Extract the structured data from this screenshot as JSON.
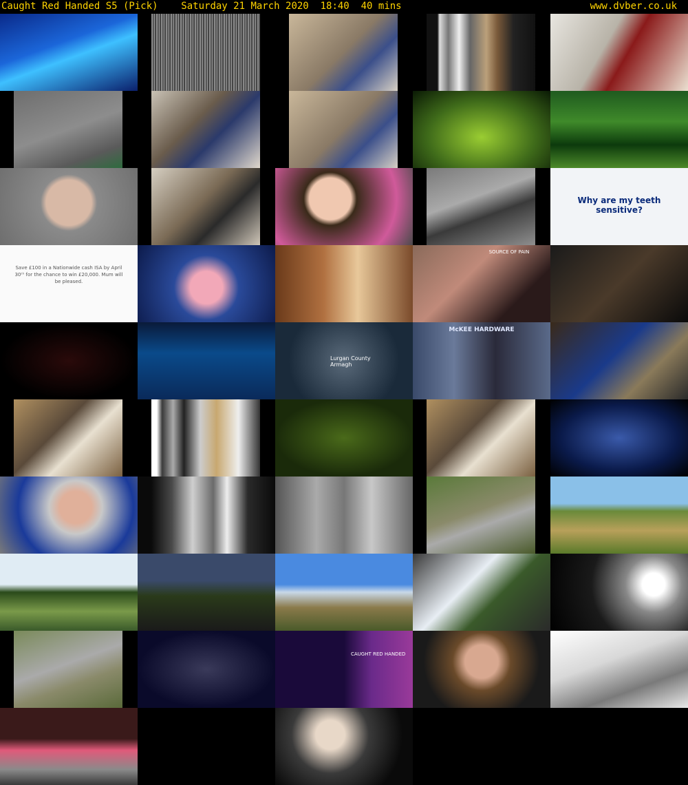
{
  "header": {
    "title": "Caught Red Handed S5 (Pick)",
    "date": "Saturday 21 March 2020",
    "time": "18:40",
    "duration": "40 mins",
    "site": "www.dvber.co.uk"
  },
  "thumbnails": [
    {
      "id": 1,
      "desc": "game-show-studio",
      "bg": "linear-gradient(160deg,#0a2a8a 0%,#1b66d9 40%,#3ec0ff 55%,#0b1f6b 100%)",
      "fit": "full"
    },
    {
      "id": 2,
      "desc": "static-noise",
      "bg": "repeating-linear-gradient(90deg,#888 0 2px,#555 2px 4px,#999 4px 5px,#444 5px 7px)",
      "fit": "pb"
    },
    {
      "id": 3,
      "desc": "cctv-shop-counter",
      "bg": "linear-gradient(135deg,#c9b79a,#8a7a66 50%,#3b4f8a 70%,#d7d0c4)",
      "fit": "pb"
    },
    {
      "id": 4,
      "desc": "grey-stripes",
      "bg": "linear-gradient(90deg,#111 0 10%,#ddd 12%,#777 20%,#eee 30%,#666 40%,#bba07a 55%,#7a5a3a 65%,#222 80%,#111)",
      "fit": "pb"
    },
    {
      "id": 5,
      "desc": "shop-aisle-man",
      "bg": "linear-gradient(120deg,#e8e6e0,#b8b3a8 40%,#8a1a1a 55%,#eadfd0)",
      "fit": "full"
    },
    {
      "id": 6,
      "desc": "pavement-cctv",
      "bg": "linear-gradient(160deg,#6e6e6e,#8d8d8d 50%,#5a5a5a 80%,#2e6b3e)",
      "fit": "pb"
    },
    {
      "id": 7,
      "desc": "cctv-struggle",
      "bg": "linear-gradient(135deg,#c9c2b5,#6a5c4c 40%,#2b3a6b 60%,#e0d8cc)",
      "fit": "pb"
    },
    {
      "id": 8,
      "desc": "cctv-shop-counter-2",
      "bg": "linear-gradient(135deg,#c9b79a,#8a7a66 50%,#3b4f8a 70%,#d7d0c4)",
      "fit": "pb"
    },
    {
      "id": 9,
      "desc": "green-graphic",
      "bg": "radial-gradient(ellipse at 50% 60%,#9acd32,#3f6b1a 55%,#0a1a05)",
      "fit": "full"
    },
    {
      "id": 10,
      "desc": "shop-front-green",
      "bg": "linear-gradient(180deg,#1f5a1f,#3f8a2a 40%,#0c3a0c 70%,#4d8a2a)",
      "fit": "full"
    },
    {
      "id": 11,
      "desc": "blurred-mugshot",
      "bg": "radial-gradient(circle at 50% 45%,#d8b9a6 0 28%,#8a8a8a 35%,#6e6e6e)",
      "fit": "full"
    },
    {
      "id": 12,
      "desc": "cctv-aisle",
      "bg": "linear-gradient(135deg,#d6cfc2,#7a6a55 45%,#2a2a2a 65%,#cfc6b8)",
      "fit": "pb"
    },
    {
      "id": 13,
      "desc": "woman-talking",
      "bg": "radial-gradient(circle at 40% 40%,#f0c8b0 0 22%,#3a2a1a 28%,#d05a9a 70%,#4a4a4a)",
      "fit": "full"
    },
    {
      "id": 14,
      "desc": "car-park-cctv",
      "bg": "linear-gradient(160deg,#7a7a7a,#aaa 40%,#3a3a3a 60%,#8e8e8e)",
      "fit": "pb"
    },
    {
      "id": 15,
      "desc": "sensitive-teeth-ad",
      "bg": "#f2f4f7",
      "fit": "full",
      "text": "Why are my teeth sensitive?"
    },
    {
      "id": 16,
      "desc": "isa-ad",
      "bg": "#fafafa",
      "fit": "full",
      "text": "Save £100 in a Nationwide cash ISA by April 30ᵗʰ for the chance to win £20,000. Mum will be pleased."
    },
    {
      "id": 17,
      "desc": "pink-dress-room",
      "bg": "radial-gradient(circle at 50% 55%,#f2a8b8 0 20%,#2a4a9a 40%,#0c1a4a)",
      "fit": "full"
    },
    {
      "id": 18,
      "desc": "chocolate-egg-girl",
      "bg": "linear-gradient(90deg,#6a3a1a,#b07040 35%,#e8c89a 60%,#7a4a2a)",
      "fit": "full"
    },
    {
      "id": 19,
      "desc": "joint-pain-ad",
      "bg": "linear-gradient(135deg,#8a6a5a,#c08a7a 40%,#2a1a1a 75%)",
      "fit": "full",
      "text": "SOURCE OF PAIN"
    },
    {
      "id": 20,
      "desc": "dark-pub",
      "bg": "linear-gradient(135deg,#1a1a1a,#4a3a2a 50%,#0a0a0a)",
      "fit": "full"
    },
    {
      "id": 21,
      "desc": "dice-graphic",
      "bg": "radial-gradient(ellipse at 50% 50%,#2a0a0a,#000 70%)",
      "fit": "full"
    },
    {
      "id": 22,
      "desc": "blue-water-graphic",
      "bg": "linear-gradient(180deg,#0a1a3a,#0a4a8a 40%,#0a2a5a)",
      "fit": "full"
    },
    {
      "id": 23,
      "desc": "map-lurgan",
      "bg": "radial-gradient(circle at 50% 50%,#5a6a7a,#1a2a3a 70%)",
      "fit": "full",
      "text": "Lurgan County Armagh"
    },
    {
      "id": 24,
      "desc": "hardware-sign",
      "bg": "linear-gradient(90deg,#3a4a6a,#6a7a9a 30%,#2a2a3a 60%,#5a6a8a)",
      "fit": "full",
      "text": "McKEE HARDWARE"
    },
    {
      "id": 25,
      "desc": "man-bike-shop",
      "bg": "linear-gradient(135deg,#3a2a1a,#1a3a8a 45%,#8a7a5a 70%,#2a2a2a)",
      "fit": "full"
    },
    {
      "id": 26,
      "desc": "shop-interior-cards",
      "bg": "linear-gradient(135deg,#b09060,#5a4a3a 40%,#e8e0d0 60%,#7a6040)",
      "fit": "pb"
    },
    {
      "id": 27,
      "desc": "stripes-shop",
      "bg": "linear-gradient(90deg,#fff 0 5%,#3a3a3a 10%,#aaa 20%,#222 30%,#ccc 45%,#c8a870 60%,#eee 80%,#333)",
      "fit": "pb"
    },
    {
      "id": 28,
      "desc": "green-logo-graphic",
      "bg": "radial-gradient(ellipse at 50% 50%,#4a6a1a,#1a2a0a 70%)",
      "fit": "full"
    },
    {
      "id": 29,
      "desc": "shop-interior-cards-2",
      "bg": "linear-gradient(135deg,#b09060,#5a4a3a 40%,#e8e0d0 60%,#7a6040)",
      "fit": "pb"
    },
    {
      "id": 30,
      "desc": "blue-frame-graphic",
      "bg": "radial-gradient(ellipse at 50% 50%,#3a5aaa,#0a1a4a 60%,#000)",
      "fit": "full"
    },
    {
      "id": 31,
      "desc": "man-glasses-talking",
      "bg": "radial-gradient(circle at 55% 40%,#e0b09a 0 18%,#c8c8c8 30%,#1a3a9a 65%,#7a7a7a)",
      "fit": "full"
    },
    {
      "id": 32,
      "desc": "dark-stripes",
      "bg": "linear-gradient(90deg,#0a0a0a 0 10%,#4a4a4a 25%,#cfcfcf 40%,#6a6a6a 55%,#eee 65%,#2a2a2a 80%,#0a0a0a)",
      "fit": "full"
    },
    {
      "id": 33,
      "desc": "grey-gradient",
      "bg": "linear-gradient(90deg,#555,#aaa 30%,#777 50%,#c8c8c8 70%,#666)",
      "fit": "full"
    },
    {
      "id": 34,
      "desc": "overgrown-path",
      "bg": "linear-gradient(160deg,#5a7a3a,#8a8a6a 45%,#aaa 60%,#4a5a2a)",
      "fit": "pb"
    },
    {
      "id": 35,
      "desc": "field-sky",
      "bg": "linear-gradient(180deg,#8ac0e8 0 35%,#6a8a3a 45%,#b8a05a 70%,#5a7a2a)",
      "fit": "full"
    },
    {
      "id": 36,
      "desc": "woman-in-grass",
      "bg": "linear-gradient(180deg,#e0ecf4 0 40%,#2a4a1a 50%,#7a9a4a 75%,#3a5a2a)",
      "fit": "full"
    },
    {
      "id": 37,
      "desc": "dusk-road",
      "bg": "linear-gradient(180deg,#3a4a6a 0 35%,#2a3a1a 55%,#1a1a1a)",
      "fit": "full"
    },
    {
      "id": 38,
      "desc": "blue-sky-field",
      "bg": "linear-gradient(180deg,#4a8ae0 0 40%,#c8d8e8 50%,#8a7a4a 70%,#4a5a2a)",
      "fit": "full"
    },
    {
      "id": 39,
      "desc": "car-boot-woman",
      "bg": "linear-gradient(135deg,#3a3a3a,#e8eef4 40%,#3a5a2a 60%,#2a2a2a)",
      "fit": "full"
    },
    {
      "id": 40,
      "desc": "car-sun-glare",
      "bg": "radial-gradient(circle at 75% 40%,#fff 0 10%,#888 25%,#1a1a1a 55%,#000)",
      "fit": "full"
    },
    {
      "id": 41,
      "desc": "path-blurred",
      "bg": "linear-gradient(160deg,#7a8a5a,#aaa 45%,#8a8a6a 65%,#5a6a3a)",
      "fit": "pb"
    },
    {
      "id": 42,
      "desc": "split-screen-car",
      "bg": "radial-gradient(ellipse at 50% 50%,#3a3a5a,#0a0a2a 70%)",
      "fit": "full"
    },
    {
      "id": 43,
      "desc": "end-credits",
      "bg": "linear-gradient(90deg,#1a0a3a 0 50%,#6a2a8a 70%,#9a3a9a)",
      "fit": "full",
      "text": "CAUGHT RED HANDED"
    },
    {
      "id": 44,
      "desc": "woman-portrait",
      "bg": "radial-gradient(circle at 50% 40%,#d8a890 0 20%,#6a4a2a 35%,#1a1a1a 70%)",
      "fit": "full"
    },
    {
      "id": 45,
      "desc": "white-ripples",
      "bg": "linear-gradient(160deg,#fff,#d8d8d8 40%,#7a7a7a 70%,#e8e8e8)",
      "fit": "full"
    },
    {
      "id": 46,
      "desc": "pink-room-stripes",
      "bg": "linear-gradient(180deg,#3a1a1a 0 40%,#e05a7a 55%,#8a8a8a 80%,#3a3a3a)",
      "fit": "full"
    },
    {
      "id": 47,
      "desc": "two-people-promo",
      "bg": "radial-gradient(circle at 40% 35%,#e8d8c8 0 15%,#3a3a3a 40%,#0a0a0a 75%)",
      "fit": "full",
      "col": 3,
      "row": 10
    }
  ]
}
